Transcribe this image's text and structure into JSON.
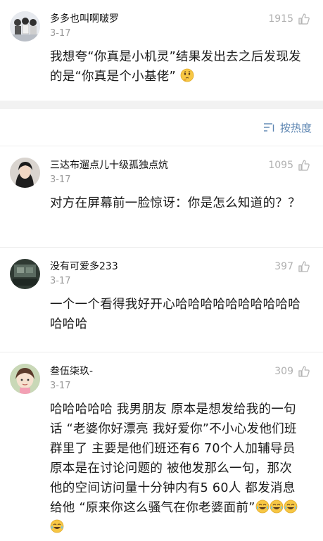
{
  "colors": {
    "separator": "#f2f2f2",
    "accent_blue": "#5b84b1",
    "muted_gray": "#9b9b9b"
  },
  "top_comment": {
    "name": "多多也叫啊啵罗",
    "date": "3-17",
    "likes": "1915",
    "text": "我想夸“你真是小机灵”结果发出去之后发现发的是“你真是个小基佬”",
    "emoji": "thinking-face-icon"
  },
  "sort": {
    "label": "按热度",
    "icon": "sort-icon"
  },
  "comments": [
    {
      "name": "三达布遛点儿十级孤独点炕",
      "date": "3-17",
      "likes": "1095",
      "text": "对方在屏幕前一脸惊讶：你是怎么知道的？？"
    },
    {
      "name": "没有可爱多233",
      "date": "3-17",
      "likes": "397",
      "text": "一个一个看得我好开心哈哈哈哈哈哈哈哈哈哈哈哈哈"
    },
    {
      "name": "叁伍柒玖-",
      "date": "3-17",
      "likes": "309",
      "text": "哈哈哈哈哈 我男朋友 原本是想发给我的一句话 “老婆你好漂亮 我好爱你”不小心发他们班群里了 主要是他们班还有6 70个人加辅导员  原本是在讨论问题的 被他发那么一句，那次 他的空间访问量十分钟内有5 60人  都发消息给他 “原来你这么骚气在你老婆面前”",
      "emoji": "laughing-crying-face-icon"
    }
  ]
}
